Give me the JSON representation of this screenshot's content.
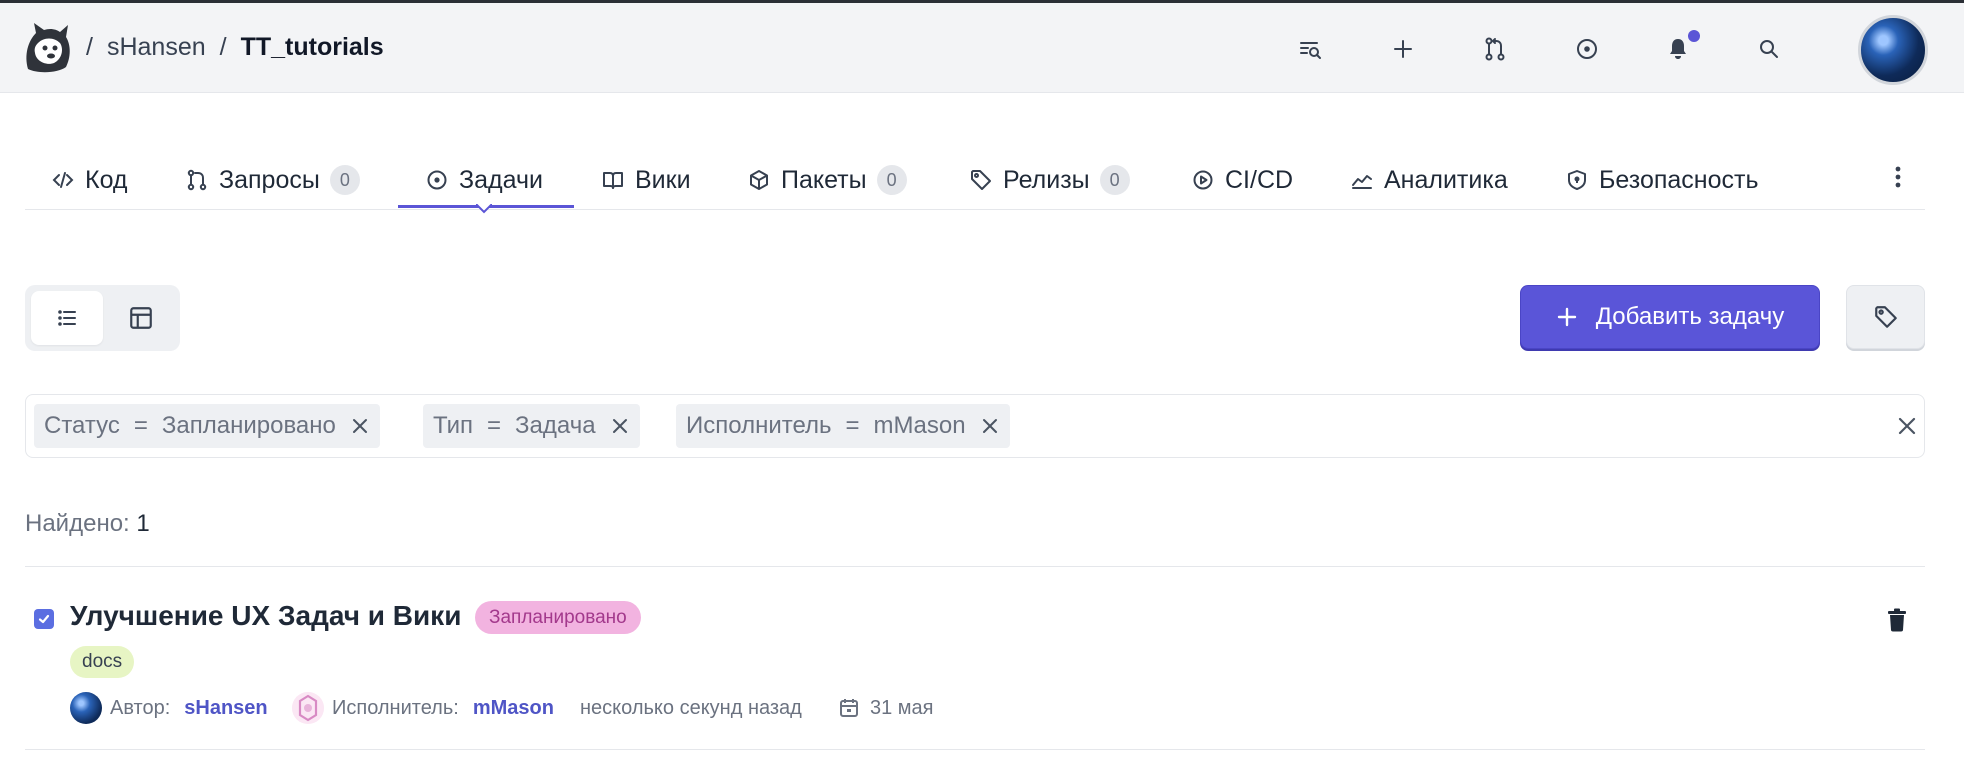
{
  "header": {
    "owner": "sHansen",
    "repo": "TT_tutorials",
    "separator": "/",
    "icons": [
      "feed-search-icon",
      "plus-icon",
      "pull-request-icon",
      "issue-icon",
      "bell-icon",
      "search-icon"
    ],
    "accent": "#5b55d6"
  },
  "tabs": [
    {
      "label": "Код",
      "icon": "code-icon"
    },
    {
      "label": "Запросы",
      "icon": "pull-request-icon",
      "badge": "0"
    },
    {
      "label": "Задачи",
      "icon": "issue-icon",
      "active": true
    },
    {
      "label": "Вики",
      "icon": "book-icon"
    },
    {
      "label": "Пакеты",
      "icon": "package-icon",
      "badge": "0"
    },
    {
      "label": "Релизы",
      "icon": "tag-icon",
      "badge": "0"
    },
    {
      "label": "CI/CD",
      "icon": "play-circle-icon"
    },
    {
      "label": "Аналитика",
      "icon": "chart-icon"
    },
    {
      "label": "Безопасность",
      "icon": "shield-icon"
    }
  ],
  "toolbar": {
    "add_label": "Добавить задачу",
    "add_color": "#5a55d8"
  },
  "filters": [
    {
      "field": "Статус",
      "op": "=",
      "value": "Запланировано"
    },
    {
      "field": "Тип",
      "op": "=",
      "value": "Задача"
    },
    {
      "field": "Исполнитель",
      "op": "=",
      "value": "mMason"
    }
  ],
  "results": {
    "found_label": "Найдено:",
    "count": "1"
  },
  "issues": [
    {
      "title": "Улучшение UX Задач и Вики",
      "status": "Запланировано",
      "status_color": "#f2b3e0",
      "label": "docs",
      "author_label": "Автор:",
      "author": "sHansen",
      "assignee_label": "Исполнитель:",
      "assignee": "mMason",
      "time": "несколько секунд назад",
      "due": "31 мая"
    }
  ]
}
